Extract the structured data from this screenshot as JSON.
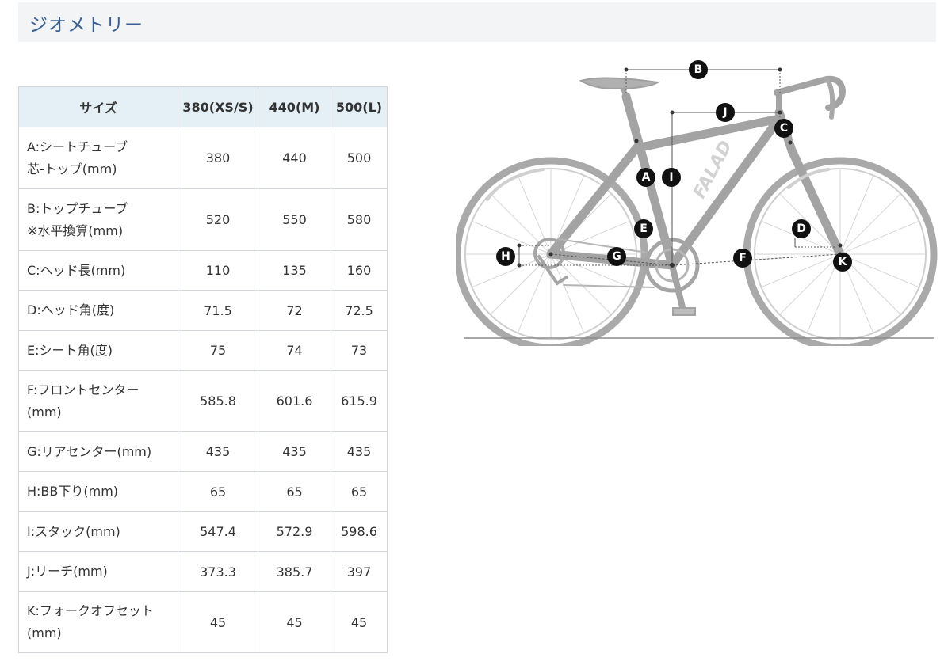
{
  "header": {
    "title": "ジオメトリー"
  },
  "table": {
    "columns": [
      "サイズ",
      "380(XS/S)",
      "440(M)",
      "500(L)"
    ],
    "rows": [
      {
        "label": "A:シートチューブ\n芯-トップ(mm)",
        "values": [
          "380",
          "440",
          "500"
        ]
      },
      {
        "label": "B:トップチューブ\n※水平換算(mm)",
        "values": [
          "520",
          "550",
          "580"
        ]
      },
      {
        "label": "C:ヘッド長(mm)",
        "values": [
          "110",
          "135",
          "160"
        ]
      },
      {
        "label": "D:ヘッド角(度)",
        "values": [
          "71.5",
          "72",
          "72.5"
        ]
      },
      {
        "label": "E:シート角(度)",
        "values": [
          "75",
          "74",
          "73"
        ]
      },
      {
        "label": "F:フロントセンター\n(mm)",
        "values": [
          "585.8",
          "601.6",
          "615.9"
        ]
      },
      {
        "label": "G:リアセンター(mm)",
        "values": [
          "435",
          "435",
          "435"
        ]
      },
      {
        "label": "H:BB下り(mm)",
        "values": [
          "65",
          "65",
          "65"
        ]
      },
      {
        "label": "I:スタック(mm)",
        "values": [
          "547.4",
          "572.9",
          "598.6"
        ]
      },
      {
        "label": "J:リーチ(mm)",
        "values": [
          "373.3",
          "385.7",
          "397"
        ]
      },
      {
        "label": "K:フォークオフセ​ット(mm)",
        "values": [
          "45",
          "45",
          "45"
        ]
      }
    ]
  },
  "diagram": {
    "frame_logo": "FALAD",
    "markers": [
      "A",
      "B",
      "C",
      "D",
      "E",
      "F",
      "G",
      "H",
      "I",
      "J",
      "K"
    ]
  }
}
